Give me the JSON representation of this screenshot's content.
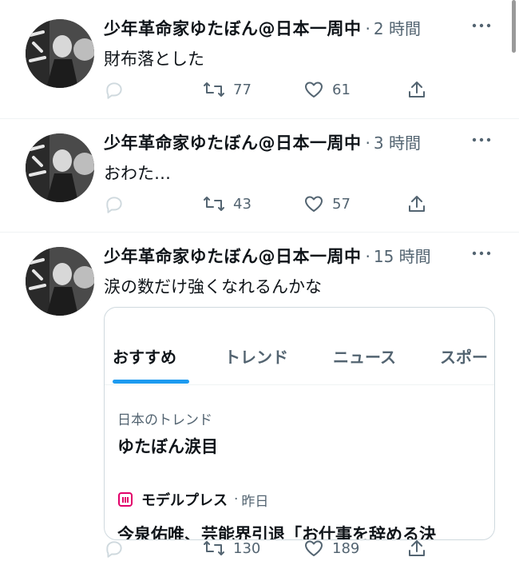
{
  "tweets": [
    {
      "author": "少年革命家ゆたぼん@日本一周中",
      "separator": "·",
      "time": "2 時間",
      "text": "財布落とした",
      "retweets": "77",
      "likes": "61"
    },
    {
      "author": "少年革命家ゆたぼん@日本一周中",
      "separator": "·",
      "time": "3 時間",
      "text": "おわた…",
      "retweets": "43",
      "likes": "57"
    },
    {
      "author": "少年革命家ゆたぼん@日本一周中",
      "separator": "·",
      "time": "15 時間",
      "text": "涙の数だけ強くなれるんかな",
      "retweets": "130",
      "likes": "189"
    }
  ],
  "trend_card": {
    "tabs": [
      "おすすめ",
      "トレンド",
      "ニュース",
      "スポー"
    ],
    "active_tab": "おすすめ",
    "trend_context": "日本のトレンド",
    "trend_name": "ゆたぼん涙目",
    "news_source": "モデルプレス",
    "news_separator": "·",
    "news_time": "昨日",
    "news_headline": "今泉佑唯、芸能界引退「お仕事を辞める決"
  },
  "colors": {
    "text_primary": "#0f1419",
    "text_secondary": "#536471",
    "accent": "#1d9bf0",
    "divider": "#eff3f4",
    "news_logo": "#e2006a"
  },
  "icons": [
    "reply-icon",
    "retweet-icon",
    "like-icon",
    "share-icon",
    "more-icon"
  ]
}
